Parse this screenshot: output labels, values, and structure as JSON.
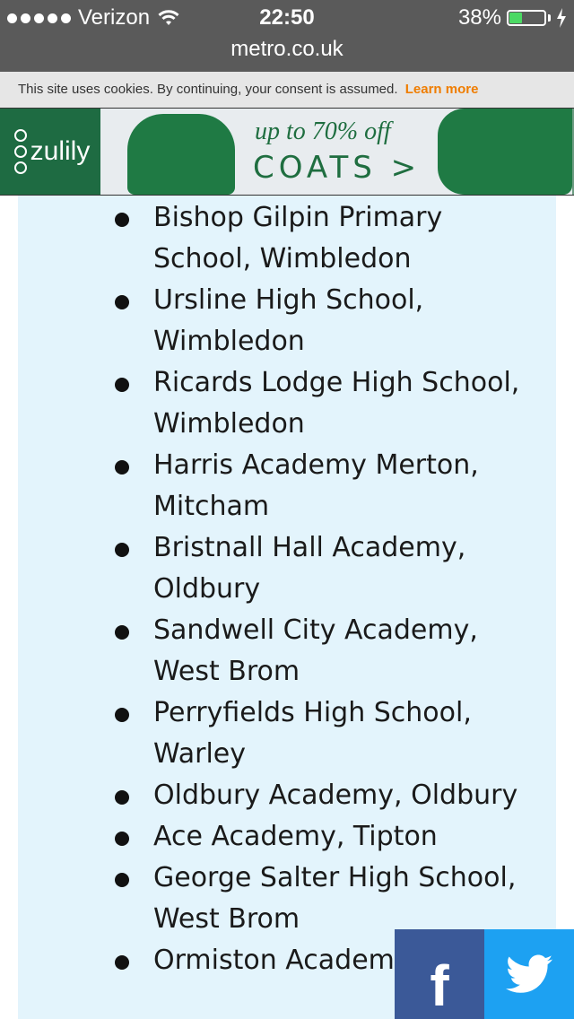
{
  "status_bar": {
    "carrier": "Verizon",
    "time": "22:50",
    "battery": "38%",
    "battery_level": 0.38,
    "icons": [
      "signal-dots-icon",
      "wifi-icon",
      "battery-icon",
      "charging-bolt-icon"
    ]
  },
  "browser": {
    "url": "metro.co.uk"
  },
  "cookie_notice": {
    "text": "This site uses cookies. By continuing, your consent is assumed.",
    "link": "Learn more"
  },
  "ad": {
    "brand": "zulily",
    "headline": "up to 70% off",
    "cta": "COATS >",
    "colors": {
      "brand_green": "#1f6e40"
    }
  },
  "article": {
    "schools": [
      "Bishop Gilpin Primary School, Wimbledon",
      "Ursline High School, Wimbledon",
      "Ricards Lodge High School, Wimbledon",
      "Harris Academy Merton, Mitcham",
      "Bristnall Hall Academy, Oldbury",
      "Sandwell City Academy, West Brom",
      "Perryfields High School, Warley",
      "Oldbury Academy, Oldbury",
      "Ace Academy, Tipton",
      "George Salter High School, West Brom",
      "Ormiston Academy Heath"
    ]
  },
  "share": {
    "facebook_label": "f",
    "icons": [
      "facebook-icon",
      "twitter-icon"
    ],
    "colors": {
      "facebook": "#3b5998",
      "twitter": "#1da1f2"
    }
  }
}
